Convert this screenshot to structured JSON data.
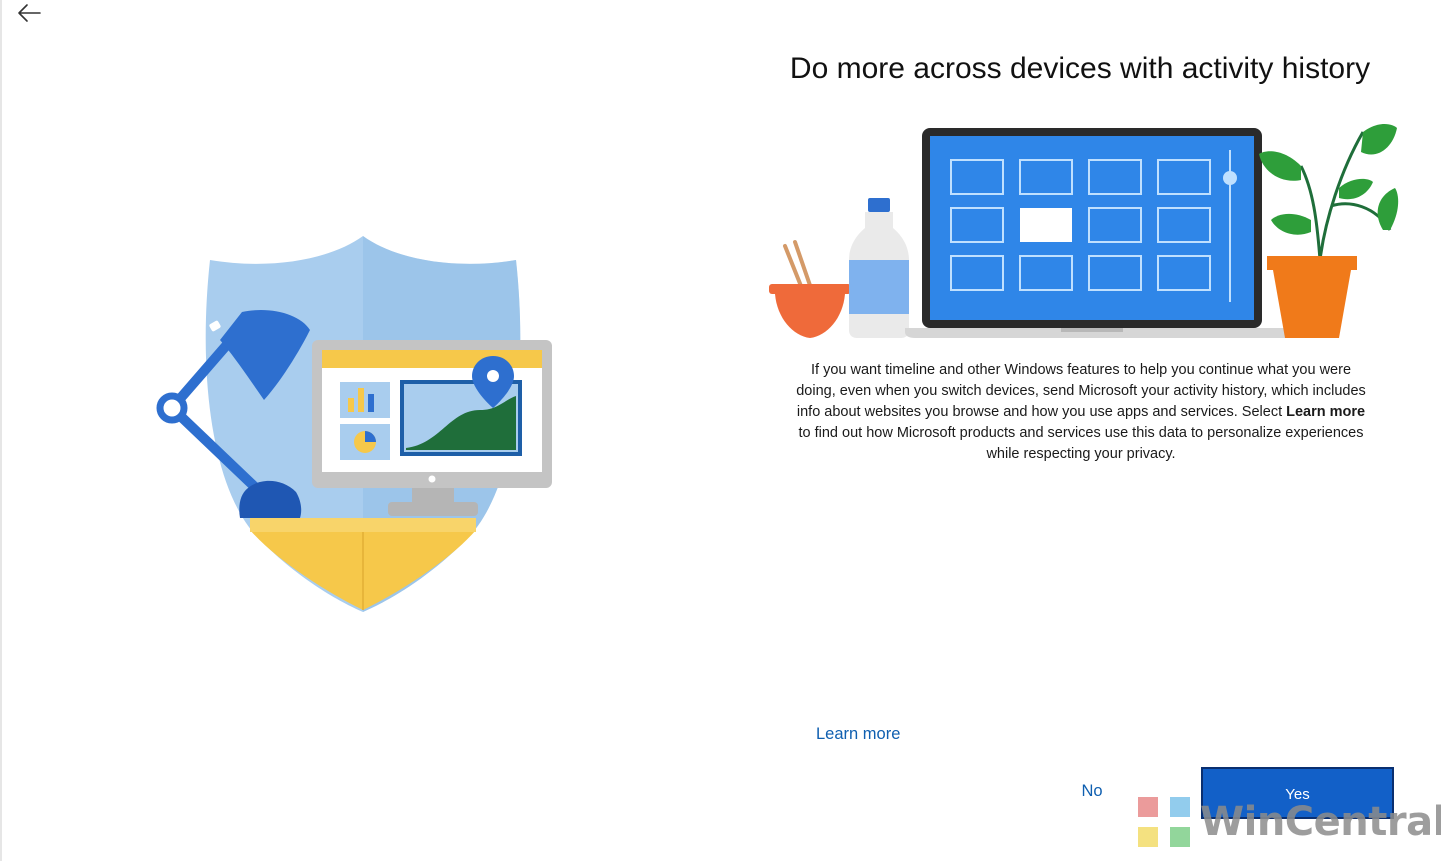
{
  "navigation": {
    "back_icon": "arrow-left-icon"
  },
  "page": {
    "title": "Do more across devices with activity history",
    "description_part1": "If you want timeline and other Windows features to help you continue what you were doing, even when you switch devices, send Microsoft your activity history, which includes info about websites you browse and how you use apps and services. Select ",
    "description_bold": "Learn more",
    "description_part2": " to find out how Microsoft products and services use this data to personalize experiences while respecting your privacy."
  },
  "actions": {
    "learn_more": "Learn more",
    "no": "No",
    "yes": "Yes"
  },
  "watermark": {
    "text": "WinCentral",
    "tile_colors": [
      "#e88a8a",
      "#7fc4ea",
      "#f3dc6a",
      "#7fcf8a"
    ]
  },
  "colors": {
    "accent": "#1260c8",
    "link": "#0f5fb0",
    "shield": "#a9cdee",
    "lamp": "#2e6fcf",
    "desk": "#f6c84a",
    "screen": "#2f86e8",
    "pot": "#f07a1a",
    "bowl": "#ef6a3a",
    "leaf": "#2e9e3a"
  }
}
